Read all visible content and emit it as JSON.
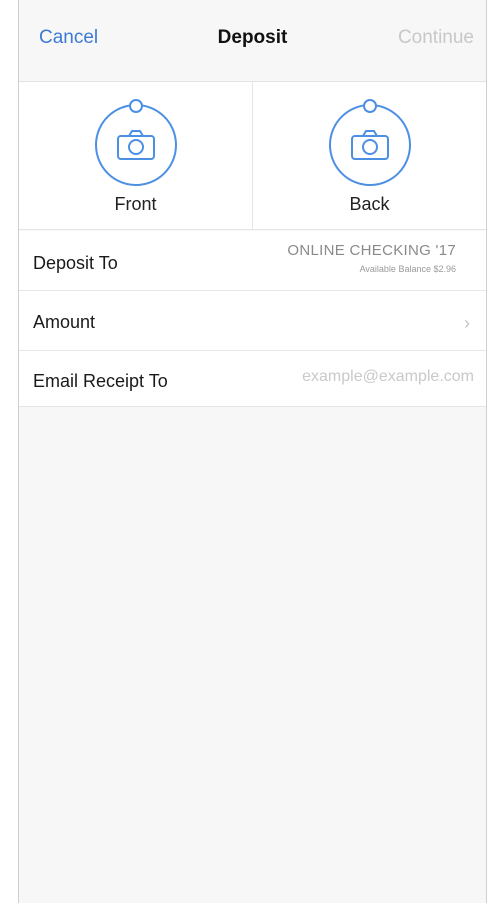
{
  "navbar": {
    "cancel_label": "Cancel",
    "title": "Deposit",
    "continue_label": "Continue"
  },
  "capture": {
    "front_label": "Front",
    "back_label": "Back",
    "icon": "camera-icon"
  },
  "form": {
    "deposit_to_label": "Deposit To",
    "account_name": "ONLINE CHECKING '17",
    "account_balance": "Available Balance $2.96",
    "amount_label": "Amount",
    "amount_chevron": "›",
    "email_label": "Email Receipt To",
    "email_value": "",
    "email_placeholder": "example@example.com"
  },
  "colors": {
    "accent": "#3d7ad6",
    "icon_blue": "#4d8fe3",
    "disabled": "#c8c8c8",
    "background": "#f7f7f7"
  }
}
